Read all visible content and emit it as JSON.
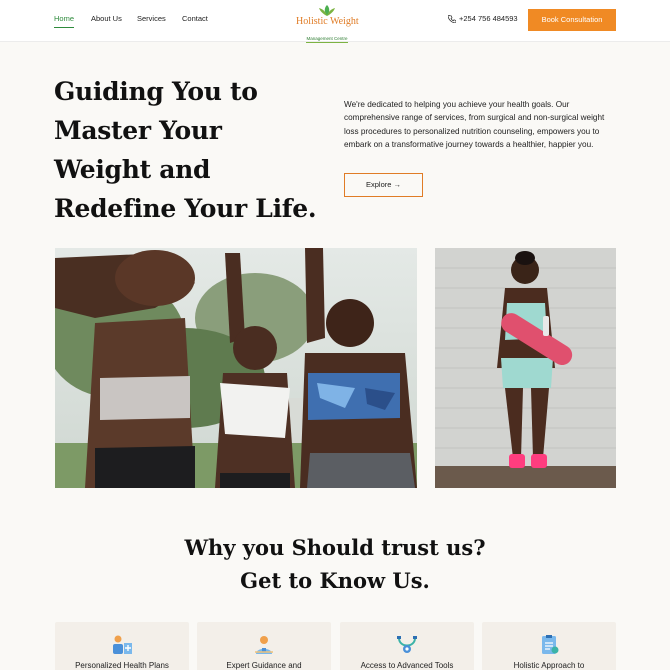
{
  "nav": {
    "links": [
      "Home",
      "About Us",
      "Services",
      "Contact"
    ],
    "logo": {
      "title": "Holistic Weight",
      "subtitle": "Management Centre"
    },
    "phone": "+254 756 484593",
    "cta": "Book Consultation"
  },
  "hero": {
    "title": "Guiding You to Master Your Weight and Redefine Your Life.",
    "description": "We're dedicated to helping you achieve your health goals. Our comprehensive range of services, from surgical and non-surgical weight loss procedures to personalized nutrition counseling, empowers you to embark on a transformative journey towards a healthier, happier you.",
    "explore": "Explore →"
  },
  "trust": {
    "line1": "Why you Should trust us?",
    "line2": "Get to Know Us."
  },
  "cards": [
    {
      "label": "Personalized Health Plans",
      "icon": "health-plan-icon"
    },
    {
      "label": "Expert Guidance and",
      "icon": "expert-guidance-icon"
    },
    {
      "label": "Access to Advanced Tools",
      "icon": "advanced-tools-icon"
    },
    {
      "label": "Holistic Approach to",
      "icon": "holistic-approach-icon"
    }
  ],
  "colors": {
    "accent": "#f08a24",
    "brand_green": "#2e8b3c",
    "background": "#faf9f6",
    "card": "#f3efe9"
  }
}
